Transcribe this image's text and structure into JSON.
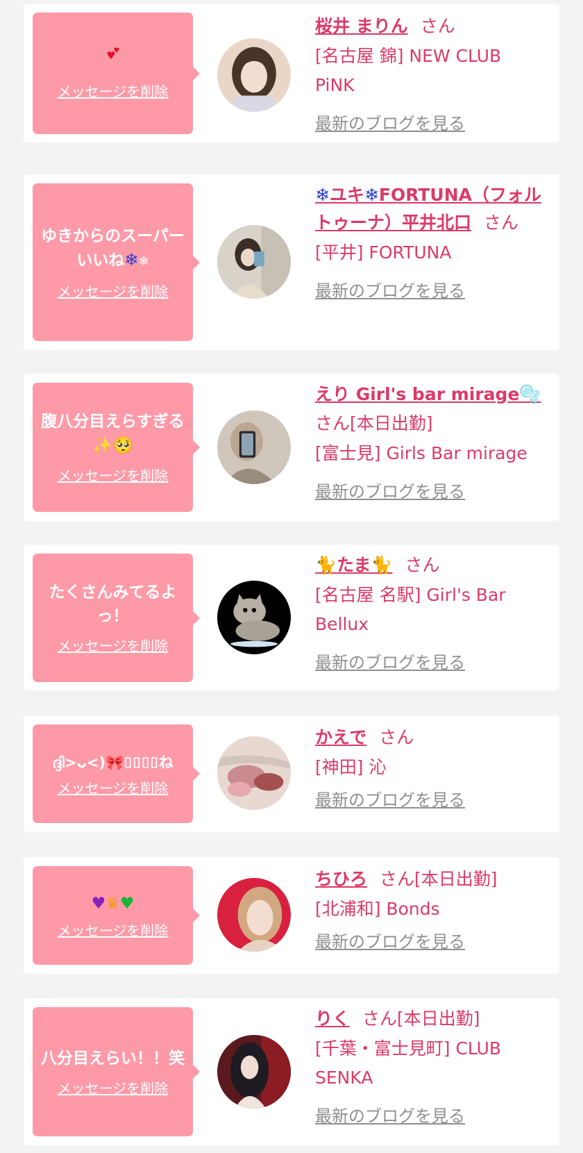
{
  "accent_color": "#db3a68",
  "bubble_color": "#fe9aa8",
  "cards": [
    {
      "message_icons": [
        "two-hearts-icon"
      ],
      "message_text": "",
      "delete_label": "メッセージを削除",
      "name": "桜井 まりん",
      "suffix": "さん",
      "shop": "[名古屋 錦] NEW CLUB PiNK",
      "blog_link": "最新のブログを見る"
    },
    {
      "message_text": "ゆきからのスーパーいいね",
      "message_icons": [
        "snowflake-icon",
        "snowflake-small-icon"
      ],
      "delete_label": "メッセージを削除",
      "name_icons": [
        "snowflake-icon",
        "snowflake-icon"
      ],
      "name_parts": [
        "ユキ",
        "FORTUNA（フォルトゥーナ）平井北口"
      ],
      "suffix": "さん",
      "shop": "[平井] FORTUNA",
      "blog_link": "最新のブログを見る"
    },
    {
      "message_text": "腹八分目えらすぎる",
      "message_icons": [
        "sparkles-icon",
        "pleading-face-icon"
      ],
      "delete_label": "メッセージを削除",
      "name": "えり Girl's bar mirage",
      "name_icons": [
        "bubbles-icon"
      ],
      "suffix": "さん[本日出勤]",
      "shop": "[富士見] Girls Bar mirage",
      "blog_link": "最新のブログを見る"
    },
    {
      "message_text": "たくさんみてるよっ！",
      "delete_label": "メッセージを削除",
      "name": "たま",
      "name_icons": [
        "black-cat-icon",
        "black-cat-icon"
      ],
      "suffix": "さん",
      "shop": "[名古屋 名駅] Girl's Bar Bellux",
      "blog_link": "最新のブログを見る"
    },
    {
      "message_text_parts": [
        "ദ്ദി>ᴗ<)",
        "⌷⌷⌷⌷ね"
      ],
      "message_icons": [
        "ribbon-icon"
      ],
      "delete_label": "メッセージを削除",
      "name": "かえで",
      "suffix": "さん",
      "shop": "[神田] 沁",
      "blog_link": "最新のブログを見る"
    },
    {
      "message_text": "",
      "message_icons": [
        "purple-heart-icon",
        "crown-icon",
        "green-heart-icon"
      ],
      "delete_label": "メッセージを削除",
      "name": "ちひろ",
      "suffix": "さん[本日出勤]",
      "shop": "[北浦和] Bonds",
      "blog_link": "最新のブログを見る"
    },
    {
      "message_text": "八分目えらい！！笑",
      "delete_label": "メッセージを削除",
      "name": "りく",
      "suffix": "さん[本日出勤]",
      "shop": "[千葉・富士見町] CLUB SENKA",
      "blog_link": "最新のブログを見る"
    }
  ]
}
